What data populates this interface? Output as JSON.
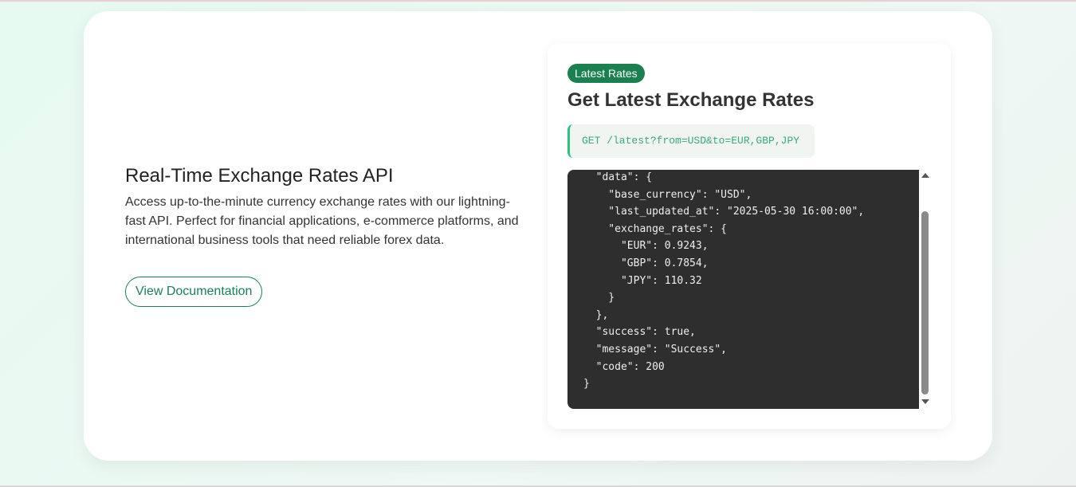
{
  "hero": {
    "title": "Real-Time Exchange Rates API",
    "description": "Access up-to-the-minute currency exchange rates with our lightning-fast API. Perfect for financial applications, e-commerce platforms, and international business tools that need reliable forex data.",
    "button_label": "View Documentation"
  },
  "panel": {
    "badge": "Latest Rates",
    "title": "Get Latest Exchange Rates",
    "endpoint": "GET /latest?from=USD&to=EUR,GBP,JPY",
    "response_code": "  \"data\": {\n    \"base_currency\": \"USD\",\n    \"last_updated_at\": \"2025-05-30 16:00:00\",\n    \"exchange_rates\": {\n      \"EUR\": 0.9243,\n      \"GBP\": 0.7854,\n      \"JPY\": 110.32\n    }\n  },\n  \"success\": true,\n  \"message\": \"Success\",\n  \"code\": 200\n}"
  },
  "colors": {
    "brand_green": "#1a8050",
    "endpoint_text": "#3aaa78",
    "code_background": "#2e2e2e"
  }
}
